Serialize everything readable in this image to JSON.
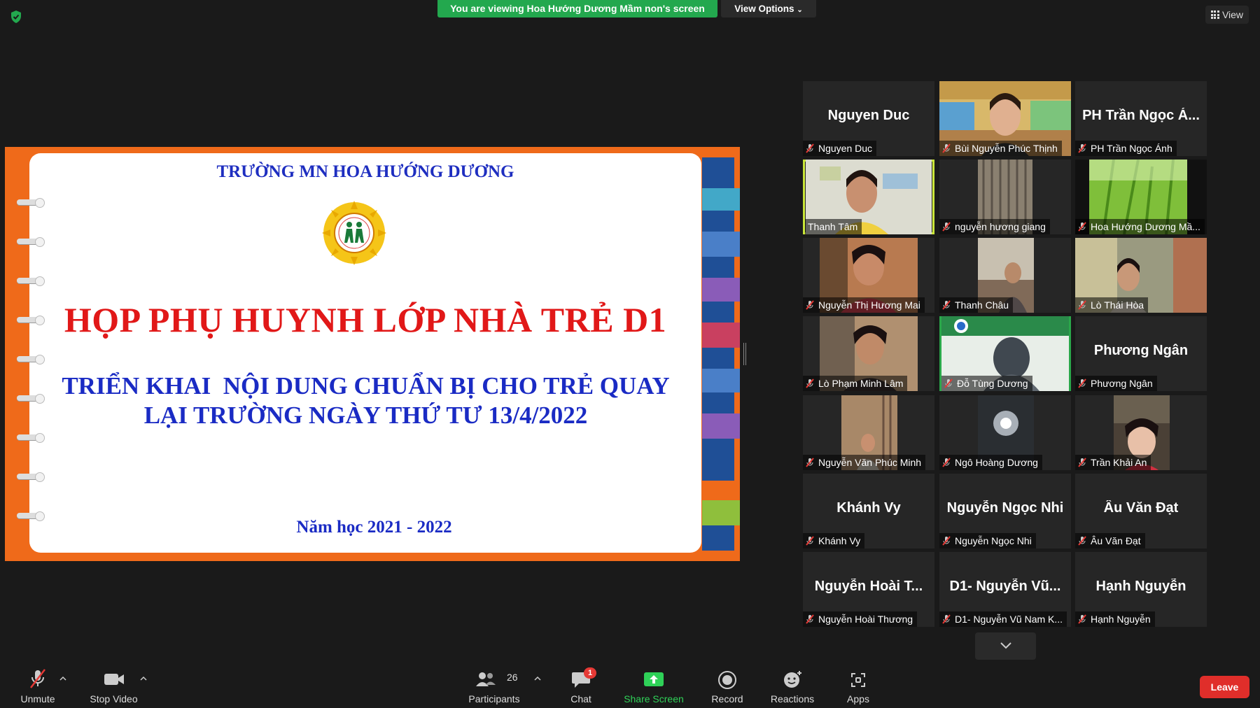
{
  "top_bar": {
    "viewing_banner": "You are viewing Hoa Hướng Dương Mầm non's screen",
    "view_options": "View Options",
    "view_button": "View"
  },
  "slide": {
    "school_name": "TRƯỜNG MN HOA HƯỚNG DƯƠNG",
    "title": "HỌP PHỤ HUYNH LỚP NHÀ TRẺ D1",
    "subtitle_line1": "TRIỂN KHAI  NỘI DUNG CHUẨN BỊ CHO TRẺ QUAY",
    "subtitle_line2": "LẠI TRƯỜNG NGÀY THỨ TƯ 13/4/2022",
    "year": "Năm học 2021 - 2022"
  },
  "gallery": {
    "tiles": [
      {
        "big": "Nguyen Duc",
        "label": "Nguyen Duc"
      },
      {
        "big": "",
        "label": "Bùi Nguyễn Phúc Thịnh"
      },
      {
        "big": "PH Trần Ngọc Á...",
        "label": "PH Trần Ngọc Ánh"
      },
      {
        "big": "",
        "label": "Thanh Tâm"
      },
      {
        "big": "",
        "label": "nguyễn hương giang"
      },
      {
        "big": "",
        "label": "Hoa Hướng Dương Mầ..."
      },
      {
        "big": "",
        "label": "Nguyễn Thị Hương Mai"
      },
      {
        "big": "",
        "label": "Thanh Châu"
      },
      {
        "big": "",
        "label": "Lò Thái Hòa"
      },
      {
        "big": "",
        "label": "Lò Phạm Minh Lâm"
      },
      {
        "big": "",
        "label": "Đỗ Tùng Dương"
      },
      {
        "big": "Phương Ngân",
        "label": "Phương Ngân"
      },
      {
        "big": "",
        "label": "Nguyễn Văn Phúc Minh"
      },
      {
        "big": "",
        "label": "Ngô Hoàng Dương"
      },
      {
        "big": "",
        "label": "Trần Khải An"
      },
      {
        "big": "Khánh Vy",
        "label": "Khánh Vy"
      },
      {
        "big": "Nguyễn Ngọc Nhi",
        "label": "Nguyễn Ngọc Nhi"
      },
      {
        "big": "Âu Văn Đạt",
        "label": "Âu Văn Đạt"
      },
      {
        "big": "Nguyễn Hoài T...",
        "label": "Nguyễn Hoài Thương"
      },
      {
        "big": "D1- Nguyễn Vũ...",
        "label": "D1- Nguyễn Vũ Nam K..."
      },
      {
        "big": "Hạnh Nguyễn",
        "label": "Hạnh Nguyễn"
      }
    ]
  },
  "toolbar": {
    "unmute": "Unmute",
    "stop_video": "Stop Video",
    "participants": "Participants",
    "participants_count": "26",
    "chat": "Chat",
    "chat_badge": "1",
    "share_screen": "Share Screen",
    "record": "Record",
    "reactions": "Reactions",
    "apps": "Apps",
    "leave": "Leave"
  },
  "colors": {
    "banner_green": "#23a84e",
    "share_green": "#2fd158",
    "leave_red": "#e02e2a",
    "active_speaker": "#c9e53a",
    "slide_orange": "#ef6a1a"
  }
}
